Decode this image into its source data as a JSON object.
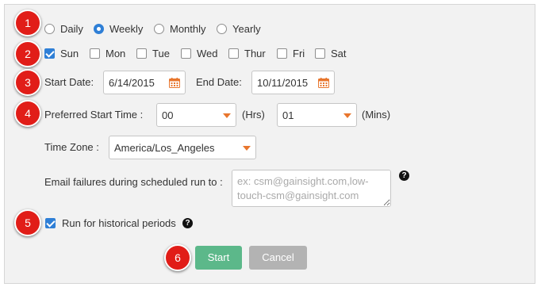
{
  "steps": [
    "1",
    "2",
    "3",
    "4",
    "5",
    "6"
  ],
  "frequency": {
    "options": [
      "Daily",
      "Weekly",
      "Monthly",
      "Yearly"
    ],
    "selected": "Weekly"
  },
  "days": {
    "items": [
      {
        "label": "Sun",
        "checked": true
      },
      {
        "label": "Mon",
        "checked": false
      },
      {
        "label": "Tue",
        "checked": false
      },
      {
        "label": "Wed",
        "checked": false
      },
      {
        "label": "Thur",
        "checked": false
      },
      {
        "label": "Fri",
        "checked": false
      },
      {
        "label": "Sat",
        "checked": false
      }
    ]
  },
  "dates": {
    "start_label": "Start Date:",
    "start_value": "6/14/2015",
    "end_label": "End Date:",
    "end_value": "10/11/2015"
  },
  "start_time": {
    "label": "Preferred Start Time :",
    "hours_value": "00",
    "hours_unit": "(Hrs)",
    "mins_value": "01",
    "mins_unit": "(Mins)"
  },
  "timezone": {
    "label": "Time Zone :",
    "value": "America/Los_Angeles"
  },
  "email": {
    "label": "Email failures during scheduled run to :",
    "placeholder": "ex: csm@gainsight.com,low-touch-csm@gainsight.com",
    "help_icon": "question-circle-icon"
  },
  "historical": {
    "label": "Run for historical periods",
    "checked": true,
    "help_icon": "question-circle-icon"
  },
  "buttons": {
    "start": "Start",
    "cancel": "Cancel"
  },
  "colors": {
    "badge": "#e11d18",
    "accent_blue": "#2f7fd6",
    "start_button": "#5cb88a",
    "cancel_button": "#b3b3b3",
    "dropdown_caret": "#e8762d",
    "calendar_icon": "#e8762d"
  }
}
